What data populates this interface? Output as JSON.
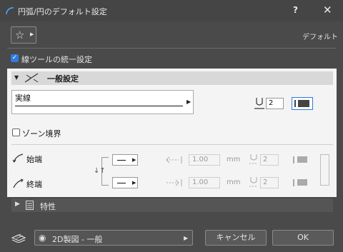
{
  "window": {
    "title": "円弧/円のデフォルト設定",
    "help_label": "?",
    "close_label": "✕"
  },
  "toolbar": {
    "favorites_icon": "star-icon",
    "default_label": "デフォルト"
  },
  "unified_settings": {
    "label": "線ツールの統一設定",
    "checked": true
  },
  "general_section": {
    "title": "一般設定",
    "expanded": true,
    "line_type": {
      "name": "実線"
    },
    "pen_number": "2",
    "zone_boundary": {
      "label": "ゾーン境界",
      "checked": false
    },
    "start": {
      "label": "始端",
      "size": "1.00",
      "unit": "mm",
      "pen": "2"
    },
    "end": {
      "label": "終端",
      "size": "1.00",
      "unit": "mm",
      "pen": "2"
    }
  },
  "properties_section": {
    "title": "特性",
    "expanded": false
  },
  "footer": {
    "view_label": "2D製図 - 一般",
    "cancel_label": "キャンセル",
    "ok_label": "OK"
  },
  "colors": {
    "accent": "#2f7be0",
    "dark_bg": "#4a4a4a",
    "panel_bg": "#f4f4f4"
  }
}
